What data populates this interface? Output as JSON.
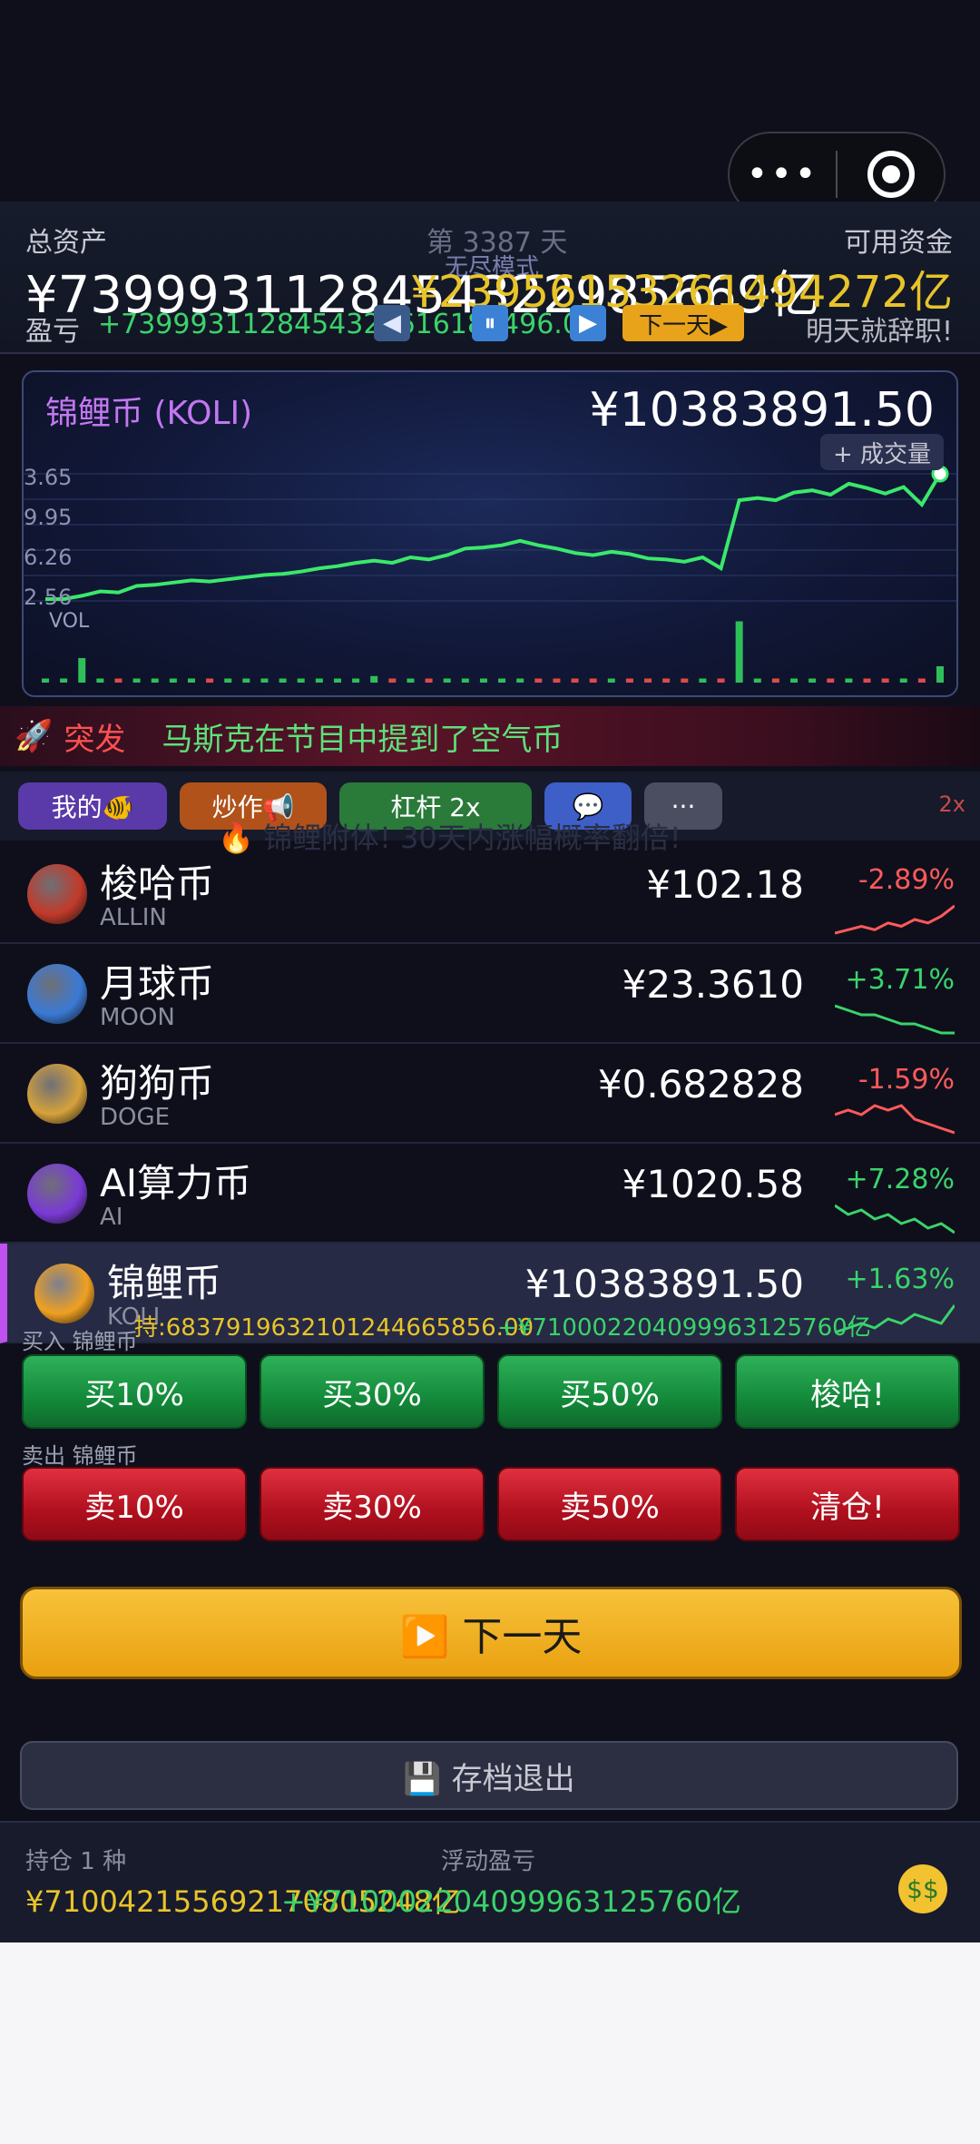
{
  "capsule": {
    "menu_glyph": "•••"
  },
  "header": {
    "total_label": "总资产",
    "day_label": "第 3387 天",
    "mode_label": "无尽模式",
    "cash_label": "可用资金",
    "total_value": "¥7399931128454322985669亿",
    "cash_value": "¥2395615326149427​2亿",
    "pnl_label": "盈亏",
    "pnl_value": "+7399931128454322616183496.0",
    "prev_glyph": "◀",
    "pause_glyph": "⏸",
    "play_glyph": "▶",
    "next_day_small": "下一天▶",
    "quit_text": "明天就辞职!"
  },
  "chart_card": {
    "title": "锦鲤币 (KOLI)",
    "price": "¥10383891.50",
    "vol_toggle": "+ 成交量",
    "vol_label": "VOL",
    "y_labels": [
      "3.65",
      "9.95",
      "6.26",
      "2.56"
    ]
  },
  "chart_data": {
    "type": "line",
    "x": [
      1,
      2,
      3,
      4,
      5,
      6,
      7,
      8,
      9,
      10,
      11,
      12,
      13,
      14,
      15,
      16,
      17,
      18,
      19,
      20,
      21,
      22,
      23,
      24,
      25,
      26,
      27,
      28,
      29,
      30,
      31,
      32,
      33,
      34,
      35,
      36,
      37,
      38,
      39,
      40,
      41,
      42,
      43,
      44,
      45,
      46,
      47,
      48,
      49,
      50
    ],
    "series": [
      {
        "values": [
          2.8,
          2.8,
          3.1,
          3.5,
          3.4,
          4.0,
          4.1,
          4.3,
          4.5,
          4.4,
          4.6,
          4.8,
          5.0,
          5.1,
          5.3,
          5.6,
          5.8,
          6.1,
          6.3,
          6.1,
          6.6,
          6.4,
          6.8,
          7.4,
          7.5,
          7.7,
          8.1,
          7.7,
          7.4,
          7.0,
          6.8,
          7.1,
          6.9,
          6.5,
          6.4,
          6.2,
          6.6,
          5.6,
          11.8,
          12.0,
          11.8,
          12.5,
          12.7,
          12.3,
          13.3,
          12.9,
          12.4,
          13.0,
          11.4,
          14.2
        ]
      }
    ],
    "volumes": [
      0.05,
      0.05,
      0.3,
      0.05,
      0.05,
      0.05,
      0.05,
      0.05,
      0.05,
      0.05,
      0.05,
      0.05,
      0.05,
      0.05,
      0.05,
      0.05,
      0.05,
      0.05,
      0.08,
      0.05,
      0.05,
      0.05,
      0.05,
      0.05,
      0.05,
      0.05,
      0.05,
      0.05,
      0.05,
      0.05,
      0.05,
      0.05,
      0.05,
      0.05,
      0.05,
      0.05,
      0.05,
      0.05,
      0.75,
      0.05,
      0.05,
      0.05,
      0.05,
      0.05,
      0.05,
      0.05,
      0.05,
      0.05,
      0.05,
      0.2
    ]
  },
  "news": {
    "icon": "🚀",
    "tag": "突发",
    "text": "马斯克在节目中提到了空气币"
  },
  "tabs": {
    "mine": "我的🐠",
    "hype": "炒作📢",
    "leverage": "杠杆 2x",
    "chat": "💬",
    "more": "···",
    "indicator": "2x"
  },
  "ghost_text": "🔥 锦鲤附体! 30天内涨幅概率翻倍!",
  "coins": [
    {
      "name": "梭哈币",
      "symbol": "ALLIN",
      "price": "¥102.18",
      "change": "-2.89%",
      "dir": "down",
      "icon_color": "#c23a2a",
      "spark": [
        0,
        1,
        2,
        1,
        3,
        2,
        4,
        3,
        5,
        8
      ]
    },
    {
      "name": "月球币",
      "symbol": "MOON",
      "price": "¥23.3610",
      "change": "+3.71%",
      "dir": "up",
      "icon_color": "#3a7ad6",
      "spark": [
        8,
        7,
        6,
        6,
        5,
        4,
        4,
        3,
        2,
        2
      ]
    },
    {
      "name": "狗狗币",
      "symbol": "DOGE",
      "price": "¥0.682828",
      "change": "-1.59%",
      "dir": "down",
      "icon_color": "#d6a23a",
      "spark": [
        5,
        6,
        5,
        7,
        6,
        7,
        4,
        3,
        2,
        1
      ]
    },
    {
      "name": "AI算力币",
      "symbol": "AI",
      "price": "¥1020.58",
      "change": "+7.28%",
      "dir": "up",
      "icon_color": "#7a3ad6",
      "spark": [
        7,
        5,
        6,
        4,
        5,
        3,
        4,
        2,
        3,
        1
      ]
    },
    {
      "name": "锦鲤币",
      "symbol": "KOLI",
      "price": "¥10383891.50",
      "change": "+1.63%",
      "dir": "up",
      "icon_color": "#f0a020",
      "spark": [
        2,
        3,
        4,
        3,
        5,
        4,
        6,
        5,
        4,
        8
      ]
    }
  ],
  "holding": {
    "line": "持:68379196321012446658​56.00",
    "pnl": "+¥71000220409996312576​0亿"
  },
  "trade": {
    "buy_label": "买入 锦鲤币",
    "buy": [
      "买10%",
      "买30%",
      "买50%",
      "梭哈!"
    ],
    "sell_label": "卖出 锦鲤币",
    "sell": [
      "卖10%",
      "卖30%",
      "卖50%",
      "清仓!"
    ]
  },
  "next_button": "▶️ 下一天",
  "save_button": "💾 存档退出",
  "footer": {
    "hold_count": "持仓 1 种",
    "float_label": "浮动盈亏",
    "hold_value": "¥71004215569217080​5248亿",
    "float_value": "+¥71000220409996312576​0亿",
    "money_icon": "$$"
  },
  "colors": {
    "up": "#3ad36a",
    "down": "#ff5a5a",
    "accent": "#c278f0",
    "gold": "#e8c42a"
  }
}
